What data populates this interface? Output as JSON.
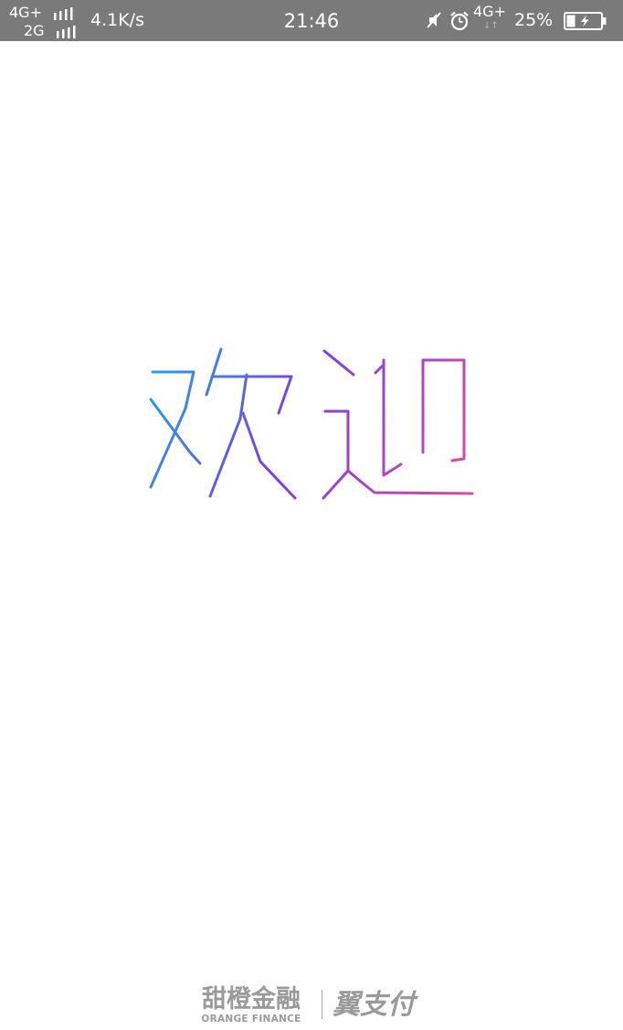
{
  "status_bar": {
    "network_1": "4G+",
    "network_2": "2G",
    "speed": "4.1K/s",
    "time": "21:46",
    "network_3": "4G+",
    "network_3_arrows": "↓↑",
    "battery_percent": "25%",
    "icons": [
      "signal-icon",
      "mute-icon",
      "alarm-icon",
      "battery-charging-icon"
    ],
    "background_color": "#7a7a7a"
  },
  "main": {
    "welcome_text": "欢迎",
    "gradient_colors": [
      "#1fa8ea",
      "#7c3ee0",
      "#e24aa2"
    ]
  },
  "footer": {
    "brand_left_cn": "甜橙金融",
    "brand_left_en": "ORANGE FINANCE",
    "brand_right": "翼支付"
  }
}
